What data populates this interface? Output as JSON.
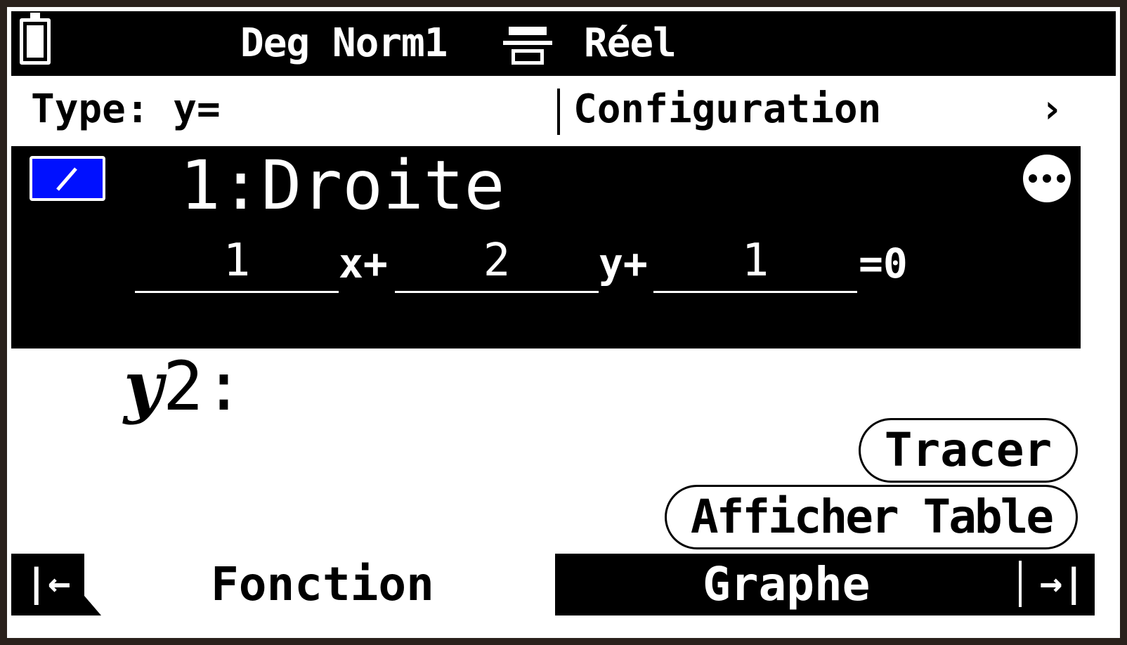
{
  "status_bar": {
    "battery_icon": "battery-full-icon",
    "mode": "Deg Norm1",
    "format_icon": "display-format-icon",
    "number_mode": "Réel"
  },
  "menu": {
    "type_label": "Type: y=",
    "config_label": "Configuration",
    "chevron": "›"
  },
  "function_list": {
    "row1": {
      "label": "1:Droite",
      "checked": true,
      "check_color": "#0010ff",
      "more_icon": "more-options-icon",
      "equation": {
        "coef_x": "1",
        "op_x": "x+",
        "coef_y": "2",
        "op_y": "y+",
        "const": "1",
        "op_eq": "=0"
      }
    },
    "row2": {
      "var": "y",
      "index": "2:"
    }
  },
  "buttons": {
    "trace": "Tracer",
    "show_table": "Afficher Table"
  },
  "bottom_nav": {
    "left_arrow": "|←",
    "tab_function": "Fonction",
    "tab_graph": "Graphe",
    "right_arrow": "→|"
  }
}
